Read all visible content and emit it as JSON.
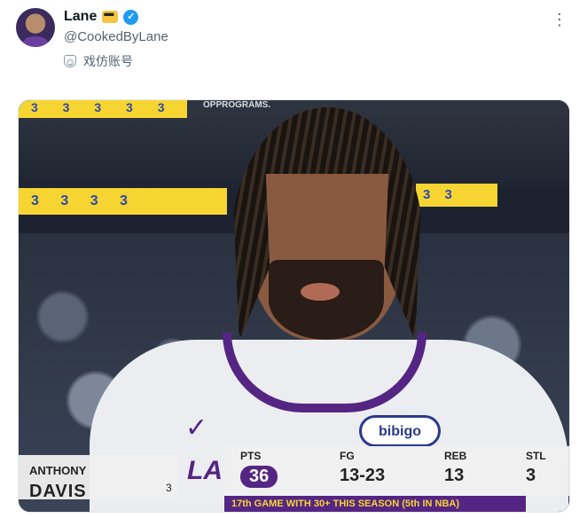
{
  "tweet": {
    "display_name": "Lane",
    "handle": "@CookedByLane",
    "label": "戏仿账号",
    "more_icon": "more-horizontal-icon",
    "avatar_icon": "avatar",
    "verified_icon": "verified-badge-icon",
    "emoji_icon": "sunglasses-emoji-icon",
    "label_icon": "parody-mask-icon"
  },
  "media": {
    "ribbon_left_top": "3 3 3 3 3",
    "ribbon_left_mid": "3 3 3 3",
    "ribbon_right_mid": "3 3",
    "arena_sign": "OPPROGRAMS.",
    "jersey_sponsor": "bibigo",
    "jersey_brand_icon": "swoosh-icon",
    "lower_third": {
      "first_name": "ANTHONY",
      "last_name": "DAVIS",
      "jersey_number": "3",
      "team_logo": "LA",
      "stats": [
        {
          "label": "PTS",
          "value": "36"
        },
        {
          "label": "FG",
          "value": "13-23"
        },
        {
          "label": "REB",
          "value": "13"
        },
        {
          "label": "STL",
          "value": "3"
        }
      ],
      "note": "17th GAME WITH 30+ THIS SEASON (5th IN NBA)"
    }
  },
  "colors": {
    "verified": "#1d9bf0",
    "lakers_purple": "#552583",
    "lakers_gold": "#f6d532"
  }
}
